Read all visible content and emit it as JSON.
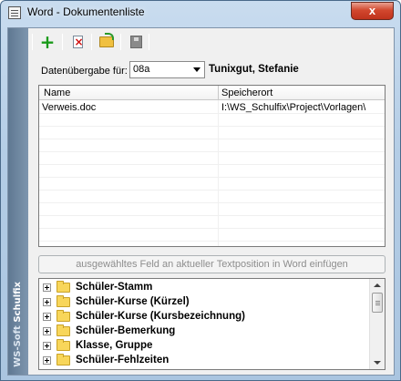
{
  "window": {
    "title": "Word - Dokumentenliste",
    "close_label": "x"
  },
  "brand": {
    "text_1": "WS-Soft ",
    "text_2": "Schulfix"
  },
  "toolbar": {
    "add": "plus-icon",
    "delete": "doc-delete-icon",
    "open": "folder-open-icon",
    "save": "save-icon"
  },
  "transfer": {
    "label": "Datenübergabe für:",
    "class_value": "08a",
    "student_name": "Tunixgut, Stefanie"
  },
  "list": {
    "columns": [
      "Name",
      "Speicherort"
    ],
    "rows": [
      {
        "name": "Verweis.doc",
        "location": "I:\\WS_Schulfix\\Project\\Vorlagen\\"
      }
    ]
  },
  "insert_button": {
    "label": "ausgewähltes Feld an aktueller Textposition in Word einfügen"
  },
  "tree": {
    "items": [
      "Schüler-Stamm",
      "Schüler-Kurse (Kürzel)",
      "Schüler-Kurse (Kursbezeichnung)",
      "Schüler-Bemerkung",
      "Klasse, Gruppe",
      "Schüler-Fehlzeiten"
    ]
  }
}
